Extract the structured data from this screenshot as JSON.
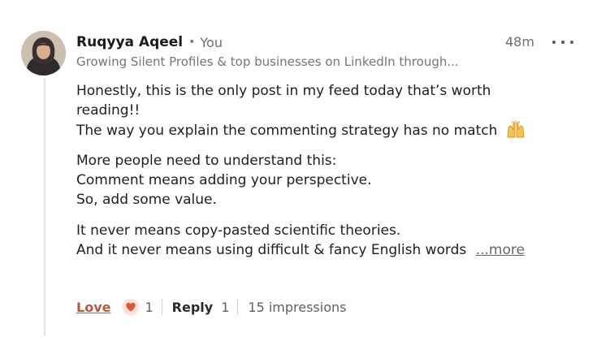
{
  "comment": {
    "author": {
      "name": "Ruqyya Aqeel",
      "separator": "•",
      "relation": "You",
      "headline": "Growing Silent Profiles & top businesses on LinkedIn through...",
      "avatar_icon": "profile-photo"
    },
    "timestamp": "48m",
    "more_options_icon": "ellipsis-icon",
    "body": {
      "paragraph1": [
        "Honestly, this is the only post in my feed today that’s worth",
        "reading!!",
        "The way you explain the commenting strategy has no match"
      ],
      "emoji_icon": "raising-hands-emoji",
      "paragraph2": [
        "More people need to understand this:",
        "Comment means adding your perspective.",
        "So, add some value."
      ],
      "paragraph3": [
        "It never means copy-pasted scientific theories.",
        "And it never means using difficult & fancy English words"
      ],
      "see_more": "...more"
    },
    "actions": {
      "reaction_label": "Love",
      "reaction_icon": "heart-reaction-icon",
      "reaction_count": "1",
      "reply_label": "Reply",
      "reply_count": "1",
      "impressions": "15 impressions"
    },
    "colors": {
      "love_accent": "#b35a3b",
      "heart_fill": "#d8583c",
      "muted_text": "#6e6e6e"
    }
  }
}
